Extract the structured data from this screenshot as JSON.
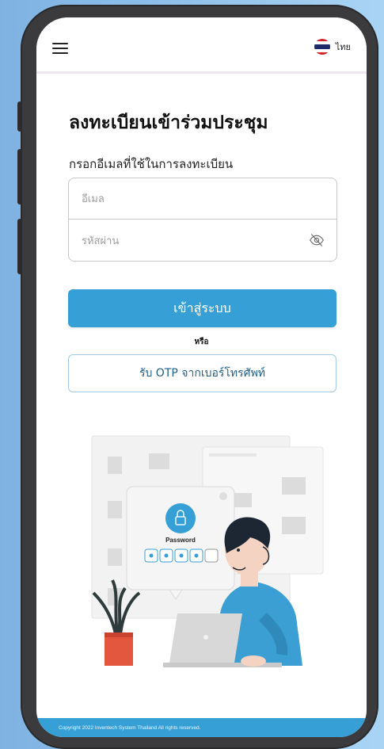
{
  "header": {
    "menu_icon": "hamburger-menu-icon",
    "language": {
      "label": "ไทย",
      "flag_icon": "thai-flag-icon"
    }
  },
  "main": {
    "title": "ลงทะเบียนเข้าร่วมประชุม",
    "subtitle": "กรอกอีเมลที่ใช้ในการลงทะเบียน",
    "email": {
      "placeholder": "อีเมล",
      "value": ""
    },
    "password": {
      "placeholder": "รหัสผ่าน",
      "value": "",
      "toggle_icon": "eye-slash-icon"
    },
    "login_label": "เข้าสู่ระบบ",
    "or_label": "หรือ",
    "otp_label": "รับ OTP จากเบอร์โทรศัพท์"
  },
  "illustration": {
    "password_card_label": "Password"
  },
  "footer": {
    "copyright": "Copyright 2022 Inventech System Thailand All rights reserved."
  },
  "colors": {
    "primary": "#36a0d6",
    "background": "#8dbfea",
    "phone_frame": "#3b3b3d"
  }
}
